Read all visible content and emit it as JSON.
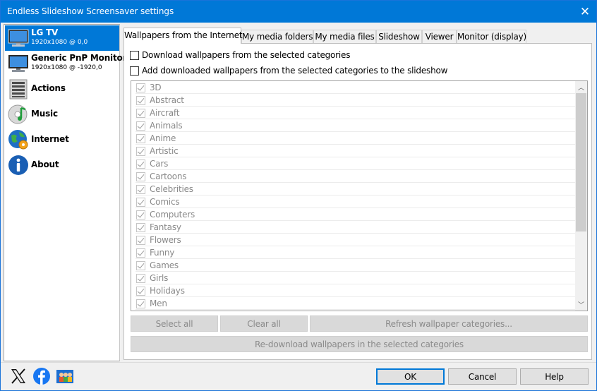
{
  "window": {
    "title": "Endless Slideshow Screensaver settings"
  },
  "sidebar": {
    "items": [
      {
        "label": "LG TV",
        "sub": "1920x1080 @ 0,0"
      },
      {
        "label": "Generic PnP Monitor",
        "sub": "1920x1080 @ -1920,0"
      },
      {
        "label": "Actions"
      },
      {
        "label": "Music"
      },
      {
        "label": "Internet"
      },
      {
        "label": "About"
      }
    ]
  },
  "tabs": [
    {
      "label": "Wallpapers from the Internet"
    },
    {
      "label": "My media folders"
    },
    {
      "label": "My media files"
    },
    {
      "label": "Slideshow"
    },
    {
      "label": "Viewer"
    },
    {
      "label": "Monitor (display)"
    }
  ],
  "panel": {
    "download_label": "Download wallpapers from the selected categories",
    "add_label": "Add downloaded wallpapers from the selected categories to the slideshow",
    "categories": [
      "3D",
      "Abstract",
      "Aircraft",
      "Animals",
      "Anime",
      "Artistic",
      "Cars",
      "Cartoons",
      "Celebrities",
      "Comics",
      "Computers",
      "Fantasy",
      "Flowers",
      "Funny",
      "Games",
      "Girls",
      "Holidays",
      "Men"
    ],
    "select_all": "Select all",
    "clear_all": "Clear all",
    "refresh": "Refresh wallpaper categories...",
    "redownload": "Re-download wallpapers in the selected categories"
  },
  "footer": {
    "ok": "OK",
    "cancel": "Cancel",
    "help": "Help"
  },
  "colors": {
    "accent": "#0078d7",
    "facebook": "#1877f2"
  }
}
